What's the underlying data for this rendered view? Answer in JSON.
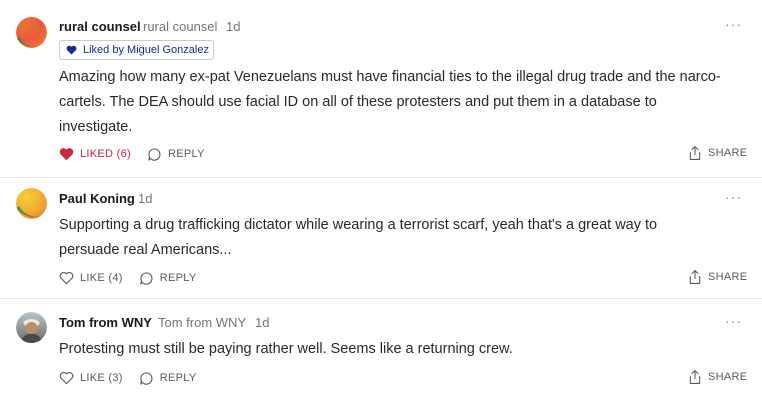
{
  "comments": [
    {
      "author": "rural counsel",
      "handle": "rural counsel",
      "time": "1d",
      "liked_by": "Liked by Miguel Gonzalez",
      "body_lines": [
        "Amazing how many ex-pat Venezuelans must have financial ties to the illegal drug trade and the narco-",
        "cartels. The DEA should use facial ID on all of these protesters and put them in a database to",
        "investigate."
      ],
      "like_label": "LIKED (6)",
      "reply_label": "REPLY",
      "share_label": "SHARE",
      "avatar_icon": "orange-gradient-avatar",
      "accent": "#c72a3f"
    },
    {
      "author": "Paul Koning",
      "time": "1d",
      "body_lines": [
        "Supporting a drug trafficking dictator while wearing a terrorist scarf, yeah that's a great way to",
        "persuade real Americans..."
      ],
      "like_label": "LIKE (4)",
      "reply_label": "REPLY",
      "share_label": "SHARE",
      "avatar_icon": "yellow-gradient-avatar"
    },
    {
      "author": "Tom from WNY",
      "handle": "Tom from WNY",
      "time": "1d",
      "body_lines": [
        "Protesting must still be paying rather well. Seems like a returning crew."
      ],
      "like_label": "LIKE (3)",
      "reply_label": "REPLY",
      "share_label": "SHARE",
      "avatar_icon": "photo-avatar"
    }
  ],
  "more_label": "···"
}
